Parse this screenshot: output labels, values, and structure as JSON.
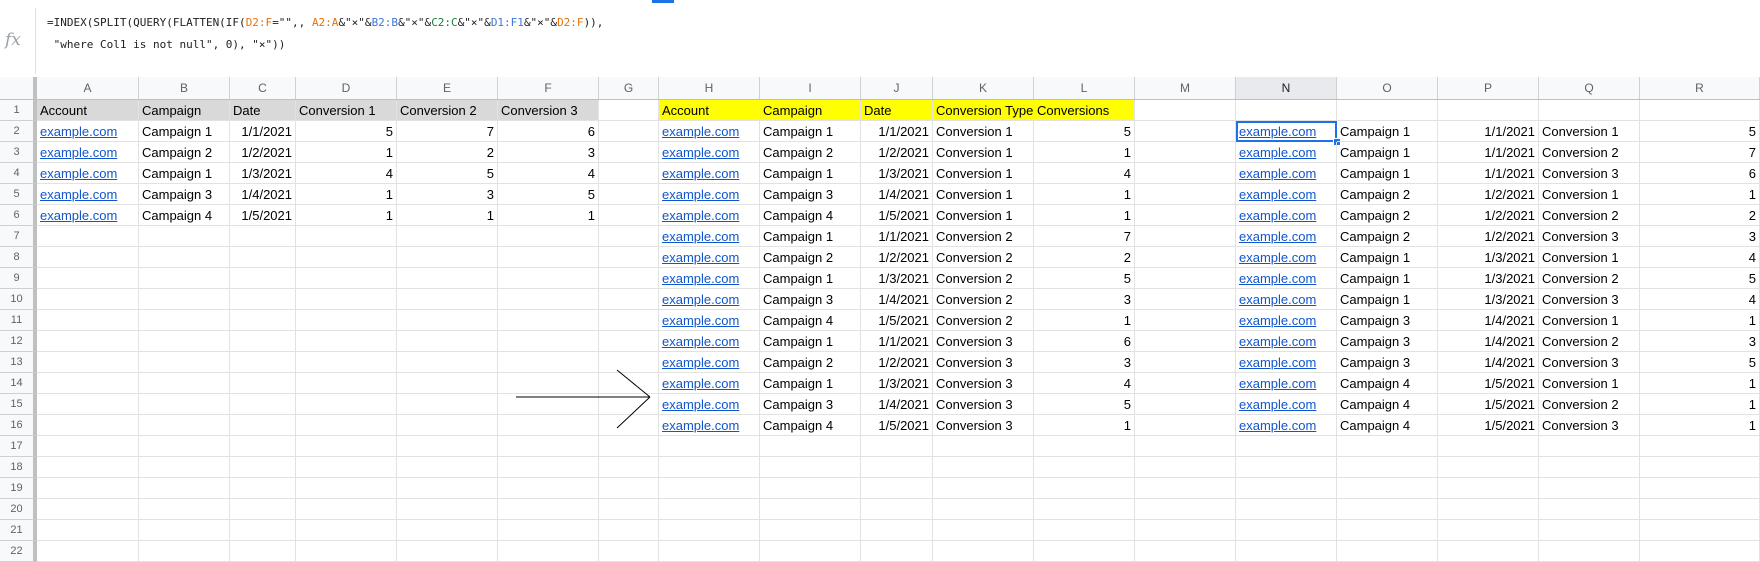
{
  "formula": {
    "line1_parts": [
      {
        "t": "=INDEX(SPLIT(QUERY(FLATTEN(IF(",
        "c": ""
      },
      {
        "t": "D2:F",
        "c": "orange"
      },
      {
        "t": "=\"\",, ",
        "c": ""
      },
      {
        "t": "A2:A",
        "c": "orange"
      },
      {
        "t": "&\"×\"&",
        "c": ""
      },
      {
        "t": "B2:B",
        "c": "blue"
      },
      {
        "t": "&\"×\"&",
        "c": ""
      },
      {
        "t": "C2:C",
        "c": "green"
      },
      {
        "t": "&\"×\"&",
        "c": ""
      },
      {
        "t": "D1:F1",
        "c": "blue"
      },
      {
        "t": "&\"×\"&",
        "c": ""
      },
      {
        "t": "D2:F",
        "c": "orange"
      },
      {
        "t": ")),",
        "c": ""
      }
    ],
    "line2": " \"where Col1 is not null\", 0), \"×\"))",
    "fx_label": "fx"
  },
  "columns": [
    "A",
    "B",
    "C",
    "D",
    "E",
    "F",
    "G",
    "H",
    "I",
    "J",
    "K",
    "L",
    "M",
    "N",
    "O",
    "P",
    "Q",
    "R"
  ],
  "selected_column": "N",
  "rows": [
    "1",
    "2",
    "3",
    "4",
    "5",
    "6",
    "7",
    "8",
    "9",
    "10",
    "11",
    "12",
    "13",
    "14",
    "15",
    "16",
    "17",
    "18",
    "19",
    "20",
    "21",
    "22"
  ],
  "source_table": {
    "headers": [
      "Account",
      "Campaign",
      "Date",
      "Conversion 1",
      "Conversion 2",
      "Conversion 3"
    ],
    "rows": [
      [
        "example.com",
        "Campaign 1",
        "1/1/2021",
        "5",
        "7",
        "6"
      ],
      [
        "example.com",
        "Campaign 2",
        "1/2/2021",
        "1",
        "2",
        "3"
      ],
      [
        "example.com",
        "Campaign 1",
        "1/3/2021",
        "4",
        "5",
        "4"
      ],
      [
        "example.com",
        "Campaign 3",
        "1/4/2021",
        "1",
        "3",
        "5"
      ],
      [
        "example.com",
        "Campaign 4",
        "1/5/2021",
        "1",
        "1",
        "1"
      ]
    ]
  },
  "result_table": {
    "headers": [
      "Account",
      "Campaign",
      "Date",
      "Conversion Type",
      "Conversions"
    ],
    "rows": [
      [
        "example.com",
        "Campaign 1",
        "1/1/2021",
        "Conversion 1",
        "5"
      ],
      [
        "example.com",
        "Campaign 2",
        "1/2/2021",
        "Conversion 1",
        "1"
      ],
      [
        "example.com",
        "Campaign 1",
        "1/3/2021",
        "Conversion 1",
        "4"
      ],
      [
        "example.com",
        "Campaign 3",
        "1/4/2021",
        "Conversion 1",
        "1"
      ],
      [
        "example.com",
        "Campaign 4",
        "1/5/2021",
        "Conversion 1",
        "1"
      ],
      [
        "example.com",
        "Campaign 1",
        "1/1/2021",
        "Conversion 2",
        "7"
      ],
      [
        "example.com",
        "Campaign 2",
        "1/2/2021",
        "Conversion 2",
        "2"
      ],
      [
        "example.com",
        "Campaign 1",
        "1/3/2021",
        "Conversion 2",
        "5"
      ],
      [
        "example.com",
        "Campaign 3",
        "1/4/2021",
        "Conversion 2",
        "3"
      ],
      [
        "example.com",
        "Campaign 4",
        "1/5/2021",
        "Conversion 2",
        "1"
      ],
      [
        "example.com",
        "Campaign 1",
        "1/1/2021",
        "Conversion 3",
        "6"
      ],
      [
        "example.com",
        "Campaign 2",
        "1/2/2021",
        "Conversion 3",
        "3"
      ],
      [
        "example.com",
        "Campaign 1",
        "1/3/2021",
        "Conversion 3",
        "4"
      ],
      [
        "example.com",
        "Campaign 3",
        "1/4/2021",
        "Conversion 3",
        "5"
      ],
      [
        "example.com",
        "Campaign 4",
        "1/5/2021",
        "Conversion 3",
        "1"
      ]
    ]
  },
  "formula_output": {
    "rows": [
      [
        "example.com",
        "Campaign 1",
        "1/1/2021",
        "Conversion 1",
        "5"
      ],
      [
        "example.com",
        "Campaign 1",
        "1/1/2021",
        "Conversion 2",
        "7"
      ],
      [
        "example.com",
        "Campaign 1",
        "1/1/2021",
        "Conversion 3",
        "6"
      ],
      [
        "example.com",
        "Campaign 2",
        "1/2/2021",
        "Conversion 1",
        "1"
      ],
      [
        "example.com",
        "Campaign 2",
        "1/2/2021",
        "Conversion 2",
        "2"
      ],
      [
        "example.com",
        "Campaign 2",
        "1/2/2021",
        "Conversion 3",
        "3"
      ],
      [
        "example.com",
        "Campaign 1",
        "1/3/2021",
        "Conversion 1",
        "4"
      ],
      [
        "example.com",
        "Campaign 1",
        "1/3/2021",
        "Conversion 2",
        "5"
      ],
      [
        "example.com",
        "Campaign 1",
        "1/3/2021",
        "Conversion 3",
        "4"
      ],
      [
        "example.com",
        "Campaign 3",
        "1/4/2021",
        "Conversion 1",
        "1"
      ],
      [
        "example.com",
        "Campaign 3",
        "1/4/2021",
        "Conversion 2",
        "3"
      ],
      [
        "example.com",
        "Campaign 3",
        "1/4/2021",
        "Conversion 3",
        "5"
      ],
      [
        "example.com",
        "Campaign 4",
        "1/5/2021",
        "Conversion 1",
        "1"
      ],
      [
        "example.com",
        "Campaign 4",
        "1/5/2021",
        "Conversion 2",
        "1"
      ],
      [
        "example.com",
        "Campaign 4",
        "1/5/2021",
        "Conversion 3",
        "1"
      ]
    ]
  },
  "colors": {
    "source_header_bg": "#d9d9d9",
    "result_header_bg": "#ffff00",
    "link": "#1155cc",
    "selection": "#1a73e8"
  }
}
